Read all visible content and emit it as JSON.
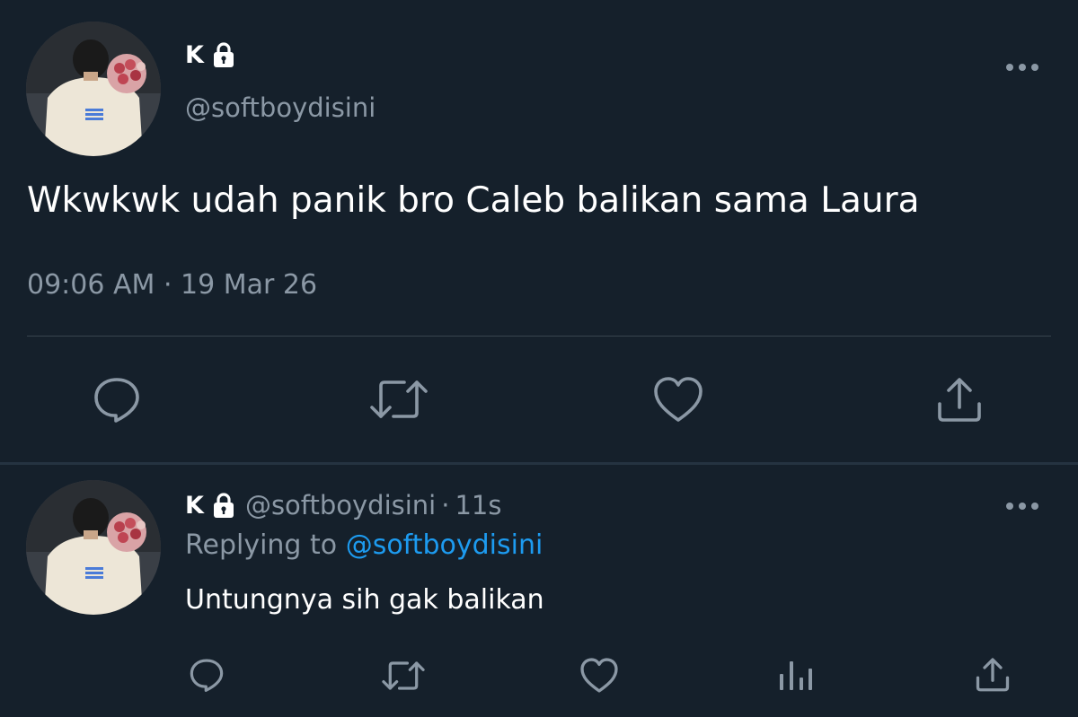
{
  "main_tweet": {
    "display_name": "K",
    "handle": "@softboydisini",
    "text": "Wkwkwk udah panik bro Caleb balikan sama Laura",
    "time": "09:06 AM",
    "separator": "·",
    "date": "19 Mar 26",
    "icons": {
      "more": "more-icon",
      "lock": "lock-icon",
      "reply": "reply-icon",
      "retweet": "retweet-icon",
      "like": "like-icon",
      "share": "share-icon"
    }
  },
  "reply_tweet": {
    "display_name": "K",
    "handle": "@softboydisini",
    "separator": "·",
    "age": "11s",
    "replying_prefix": "Replying to",
    "replying_to": "@softboydisini",
    "text": "Untungnya sih gak balikan",
    "icons": {
      "more": "more-icon",
      "lock": "lock-icon",
      "reply": "reply-icon",
      "retweet": "retweet-icon",
      "like": "like-icon",
      "analytics": "analytics-icon",
      "share": "share-icon"
    }
  },
  "colors": {
    "background": "#15202b",
    "text_primary": "#ffffff",
    "text_secondary": "#8b98a5",
    "accent": "#1d9bf0",
    "divider": "#38444d"
  }
}
